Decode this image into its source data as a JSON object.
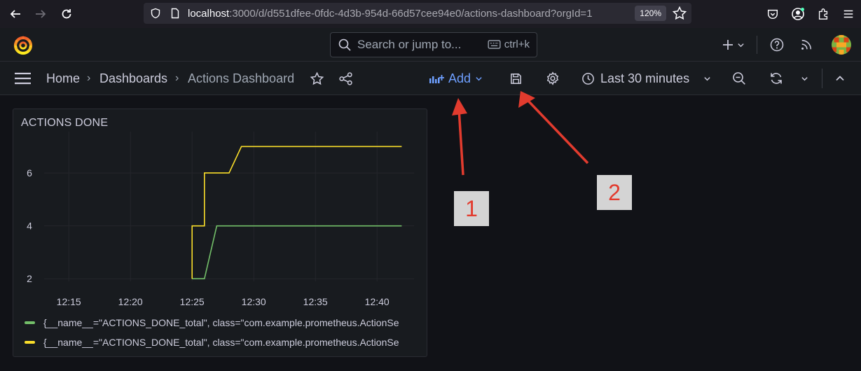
{
  "browser": {
    "url_host": "localhost",
    "url_rest": ":3000/d/d551dfee-0fdc-4d3b-954d-66d57cee94e0/actions-dashboard?orgId=1",
    "zoom": "120%"
  },
  "topbar": {
    "search_placeholder": "Search or jump to...",
    "shortcut": "ctrl+k"
  },
  "breadcrumb": {
    "home": "Home",
    "dashboards": "Dashboards",
    "current": "Actions Dashboard"
  },
  "toolbar": {
    "add_label": "Add",
    "time_range": "Last 30 minutes"
  },
  "panel": {
    "title": "ACTIONS DONE"
  },
  "annotations": {
    "label_1": "1",
    "label_2": "2"
  },
  "colors": {
    "green": "#73bf69",
    "yellow": "#fade2a",
    "accent_blue": "#6e9fff",
    "annotation_red": "#e23b2e"
  },
  "chart_data": {
    "type": "line",
    "title": "ACTIONS DONE",
    "x_ticks": [
      "12:15",
      "12:20",
      "12:25",
      "12:30",
      "12:35",
      "12:40"
    ],
    "y_ticks": [
      "2",
      "4",
      "6"
    ],
    "xlim": [
      "12:13",
      "12:43"
    ],
    "ylim": [
      1.9,
      7.3
    ],
    "grid": true,
    "legend_position": "bottom",
    "series": [
      {
        "legend": "{__name__=\"ACTIONS_DONE_total\", class=\"com.example.prometheus.ActionSe",
        "color": "#73bf69",
        "points": [
          [
            "12:25",
            2
          ],
          [
            "12:26",
            2
          ],
          [
            "12:27",
            4
          ],
          [
            "12:42",
            4
          ]
        ]
      },
      {
        "legend": "{__name__=\"ACTIONS_DONE_total\", class=\"com.example.prometheus.ActionSe",
        "color": "#fade2a",
        "points": [
          [
            "12:25",
            2
          ],
          [
            "12:25",
            4
          ],
          [
            "12:26",
            4
          ],
          [
            "12:26",
            6
          ],
          [
            "12:28",
            6
          ],
          [
            "12:29",
            7
          ],
          [
            "12:42",
            7
          ]
        ]
      }
    ]
  }
}
